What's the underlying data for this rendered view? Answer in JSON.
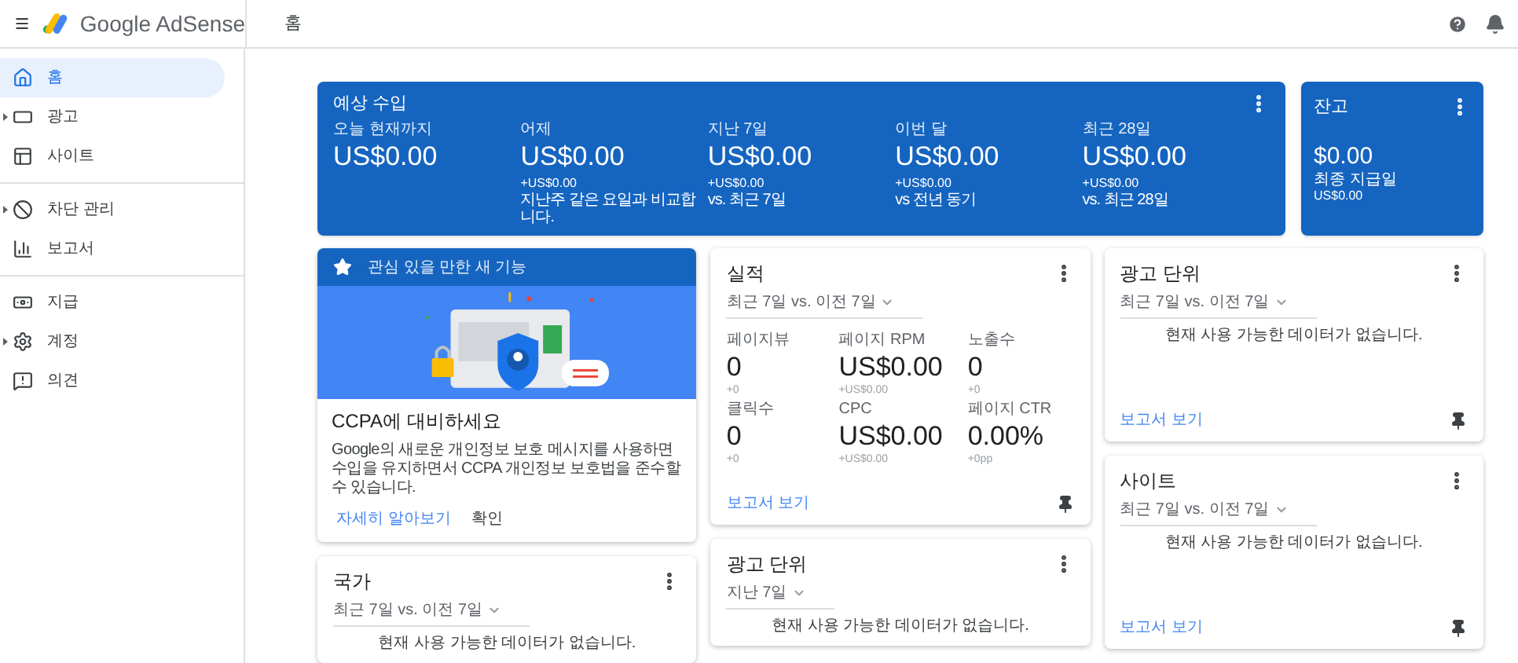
{
  "header": {
    "product": "Google AdSense",
    "page_title": "홈"
  },
  "sidebar": {
    "groups": [
      {
        "items": [
          {
            "label": "홈",
            "selected": true,
            "expandable": false
          },
          {
            "label": "광고",
            "selected": false,
            "expandable": true
          },
          {
            "label": "사이트",
            "selected": false,
            "expandable": false
          }
        ]
      },
      {
        "items": [
          {
            "label": "차단 관리",
            "selected": false,
            "expandable": true
          },
          {
            "label": "보고서",
            "selected": false,
            "expandable": false
          }
        ]
      },
      {
        "items": [
          {
            "label": "지급",
            "selected": false,
            "expandable": false
          },
          {
            "label": "계정",
            "selected": false,
            "expandable": true
          },
          {
            "label": "의견",
            "selected": false,
            "expandable": false
          }
        ]
      }
    ]
  },
  "earnings": {
    "title": "예상 수입",
    "metrics": [
      {
        "label": "오늘 현재까지",
        "value": "US$0.00"
      },
      {
        "label": "어제",
        "value": "US$0.00",
        "delta": "+US$0.00",
        "comparison": "지난주 같은 요일과 비교합니다."
      },
      {
        "label": "지난 7일",
        "value": "US$0.00",
        "delta": "+US$0.00",
        "comparison": "vs. 최근 7일"
      },
      {
        "label": "이번 달",
        "value": "US$0.00",
        "delta": "+US$0.00",
        "comparison": "vs 전년 동기"
      },
      {
        "label": "최근 28일",
        "value": "US$0.00",
        "delta": "+US$0.00",
        "comparison": "vs. 최근 28일"
      }
    ]
  },
  "balance": {
    "title": "잔고",
    "value": "$0.00",
    "last_payment_label": "최종 지급일",
    "last_payment_value": "US$0.00"
  },
  "columns": [
    [
      {
        "kind": "feature",
        "banner": "관심 있을 만한 새 기능",
        "heading": "CCPA에 대비하세요",
        "body": "Google의 새로운 개인정보 보호 메시지를 사용하면 수입을 유지하면서 CCPA 개인정보 보호법을 준수할 수 있습니다.",
        "actions": [
          {
            "label": "자세히 알아보기",
            "kind": "link"
          },
          {
            "label": "확인",
            "kind": "button"
          }
        ]
      },
      {
        "kind": "report",
        "title": "국가",
        "period": "최근 7일 vs. 이전 7일",
        "message": "현재 사용 가능한 데이터가 없습니다."
      }
    ],
    [
      {
        "kind": "report",
        "title": "실적",
        "period": "최근 7일 vs. 이전 7일",
        "metrics": [
          {
            "label": "페이지뷰",
            "value": "0",
            "delta": "+0"
          },
          {
            "label": "페이지 RPM",
            "value": "US$0.00",
            "delta": "+US$0.00"
          },
          {
            "label": "노출수",
            "value": "0",
            "delta": "+0"
          },
          {
            "label": "클릭수",
            "value": "0",
            "delta": "+0"
          },
          {
            "label": "CPC",
            "value": "US$0.00",
            "delta": "+US$0.00"
          },
          {
            "label": "페이지 CTR",
            "value": "0.00%",
            "delta": "+0pp"
          }
        ],
        "link": "보고서 보기"
      },
      {
        "kind": "report",
        "title": "광고 단위",
        "period": "지난 7일",
        "message": "현재 사용 가능한 데이터가 없습니다."
      }
    ],
    [
      {
        "kind": "report",
        "title": "광고 단위",
        "period": "최근 7일 vs. 이전 7일",
        "message": "현재 사용 가능한 데이터가 없습니다.",
        "link": "보고서 보기"
      },
      {
        "kind": "report",
        "title": "사이트",
        "period": "최근 7일 vs. 이전 7일",
        "message": "현재 사용 가능한 데이터가 없습니다.",
        "link": "보고서 보기"
      }
    ]
  ]
}
